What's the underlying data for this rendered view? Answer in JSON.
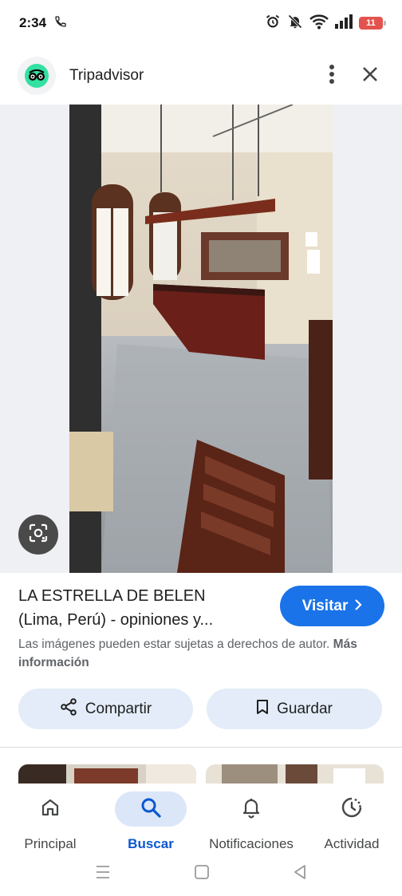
{
  "status_bar": {
    "time": "2:34",
    "battery": "11",
    "icons": [
      "phone-icon",
      "alarm-icon",
      "mute-icon",
      "wifi-icon",
      "signal-icon",
      "battery-icon"
    ]
  },
  "header": {
    "site_name": "Tripadvisor",
    "logo_icon": "tripadvisor-owl-icon",
    "more_icon": "more-vert-icon",
    "close_icon": "close-icon"
  },
  "image": {
    "description_icon": "lens-icon"
  },
  "result": {
    "title_line1": "LA ESTRELLA DE BELEN",
    "title_line2": "(Lima, Perú) - opiniones y...",
    "visit_label": "Visitar",
    "copyright_text": "Las imágenes pueden estar sujetas a derechos de autor.",
    "more_info_label": "Más información",
    "share_label": "Compartir",
    "save_label": "Guardar"
  },
  "bottom_nav": {
    "items": [
      {
        "label": "Principal",
        "icon": "home-icon",
        "active": false
      },
      {
        "label": "Buscar",
        "icon": "search-icon",
        "active": true
      },
      {
        "label": "Notificaciones",
        "icon": "bell-icon",
        "active": false
      },
      {
        "label": "Actividad",
        "icon": "activity-icon",
        "active": false
      }
    ]
  },
  "colors": {
    "accent": "#1a73e8",
    "pill_bg": "#e3ecf8",
    "active_nav_bg": "#dbe6f8",
    "active_nav_text": "#0b57d0",
    "tripadvisor_green": "#34e0a1"
  }
}
